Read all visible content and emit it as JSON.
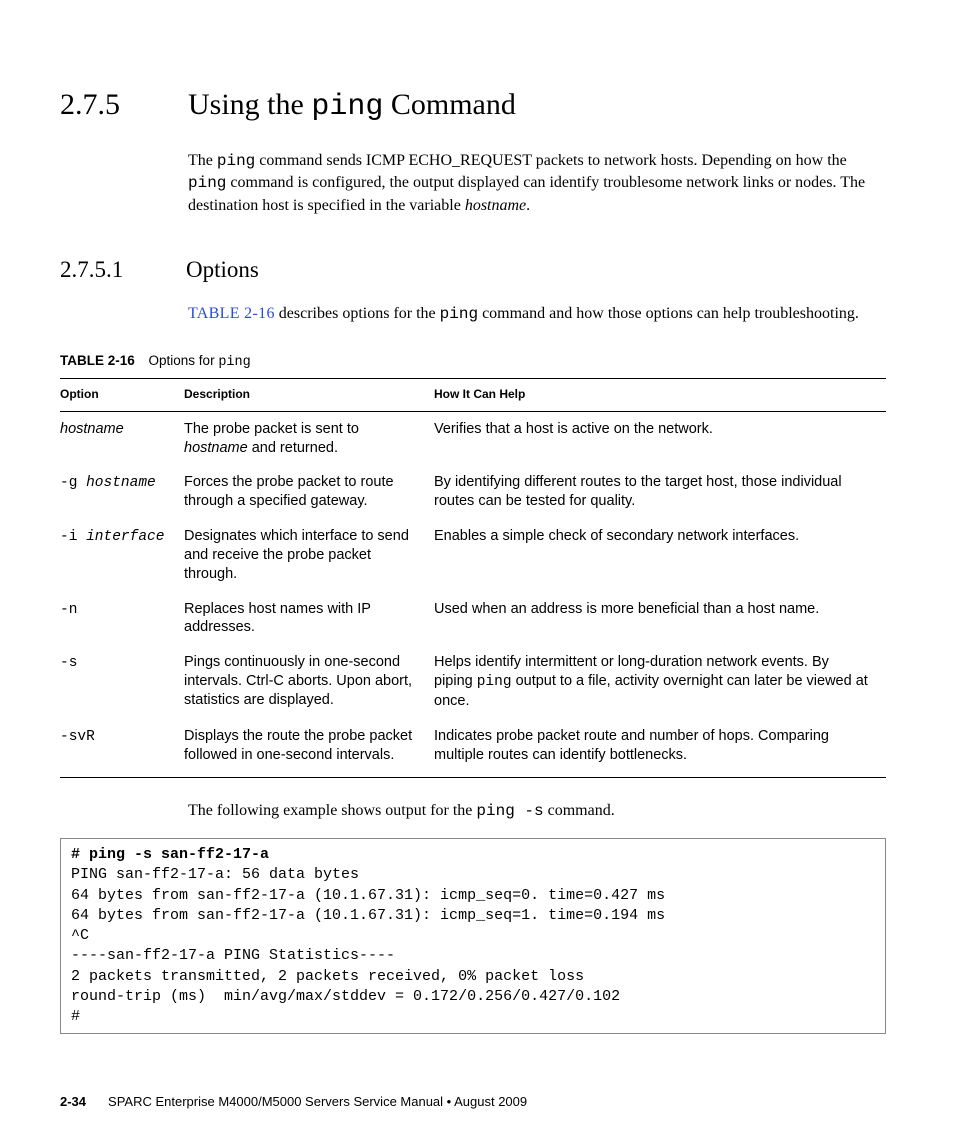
{
  "section": {
    "number": "2.7.5",
    "title_pre": "Using the ",
    "title_cmd": "ping",
    "title_post": " Command"
  },
  "intro": {
    "p1_a": "The ",
    "p1_cmd1": "ping",
    "p1_b": " command sends ICMP ECHO_REQUEST packets to network hosts. Depending on how the ",
    "p1_cmd2": "ping",
    "p1_c": " command is configured, the output displayed can identify troublesome network links or nodes. The destination host is specified in the variable ",
    "p1_var": "hostname",
    "p1_d": "."
  },
  "subsection": {
    "number": "2.7.5.1",
    "title": "Options"
  },
  "options_para": {
    "ref": "TABLE 2-16",
    "a": " describes options for the ",
    "cmd": "ping",
    "b": " command and how those options can help troubleshooting."
  },
  "table_caption": {
    "lead": "TABLE 2-16",
    "text_a": "Options for ",
    "text_cmd": "ping"
  },
  "table": {
    "head": {
      "c1": "Option",
      "c2": "Description",
      "c3": "How It Can Help"
    },
    "rows": [
      {
        "opt_pre": "",
        "opt_var": "hostname",
        "desc_a": "The probe packet is sent to ",
        "desc_var": "hostname",
        "desc_b": " and returned.",
        "help": "Verifies that a host is active on the network."
      },
      {
        "opt_pre": "-g ",
        "opt_var": "hostname",
        "desc_a": "Forces the probe packet to route through a specified gateway.",
        "desc_var": "",
        "desc_b": "",
        "help": "By identifying different routes to the target host, those individual routes can be tested for quality."
      },
      {
        "opt_pre": "-i ",
        "opt_var": "interface",
        "desc_a": "Designates which interface to send and receive the probe packet through.",
        "desc_var": "",
        "desc_b": "",
        "help": "Enables a simple check of secondary network interfaces."
      },
      {
        "opt_pre": "-n",
        "opt_var": "",
        "desc_a": "Replaces host names with IP addresses.",
        "desc_var": "",
        "desc_b": "",
        "help": "Used when an address is more beneficial than a host name."
      },
      {
        "opt_pre": "-s",
        "opt_var": "",
        "desc_a": "Pings continuously in one-second intervals. Ctrl-C aborts. Upon abort, statistics are displayed.",
        "desc_var": "",
        "desc_b": "",
        "help_a": "Helps identify intermittent or long-duration network events. By piping ",
        "help_cmd": "ping",
        "help_b": " output to a file, activity overnight can later be viewed at once."
      },
      {
        "opt_pre": "-svR",
        "opt_var": "",
        "desc_a": "Displays the route the probe packet followed in one-second intervals.",
        "desc_var": "",
        "desc_b": "",
        "help": "Indicates probe packet route and number of hops. Comparing multiple routes can identify bottlenecks."
      }
    ]
  },
  "example_para": {
    "a": "The following example shows output for the ",
    "cmd": "ping -s",
    "b": " command."
  },
  "code": {
    "cmd": "# ping -s san-ff2-17-a",
    "body": "PING san-ff2-17-a: 56 data bytes\n64 bytes from san-ff2-17-a (10.1.67.31): icmp_seq=0. time=0.427 ms\n64 bytes from san-ff2-17-a (10.1.67.31): icmp_seq=1. time=0.194 ms\n^C\n----san-ff2-17-a PING Statistics----\n2 packets transmitted, 2 packets received, 0% packet loss\nround-trip (ms)  min/avg/max/stddev = 0.172/0.256/0.427/0.102\n#"
  },
  "footer": {
    "page": "2-34",
    "text": "SPARC Enterprise M4000/M5000 Servers Service Manual • August 2009"
  }
}
